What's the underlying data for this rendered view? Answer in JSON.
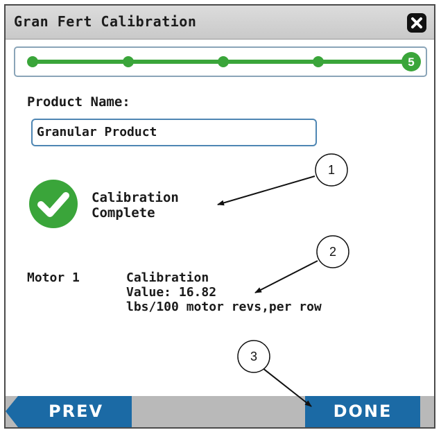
{
  "window": {
    "title": "Gran Fert Calibration"
  },
  "progress": {
    "total_steps": 5,
    "current_step": 5,
    "current_step_label": "5",
    "color": "#3aa53a"
  },
  "product": {
    "label": "Product Name:",
    "value": "Granular Product"
  },
  "status": {
    "line1": "Calibration",
    "line2": "Complete",
    "check_color": "#3aa53a"
  },
  "motor": {
    "label": "Motor 1",
    "line1": "Calibration",
    "line2": "Value: 16.82",
    "line3": "lbs/100 motor revs,per row"
  },
  "buttons": {
    "prev": "PREV",
    "done": "DONE",
    "color": "#1b6aa5"
  },
  "callouts": [
    "1",
    "2",
    "3"
  ]
}
